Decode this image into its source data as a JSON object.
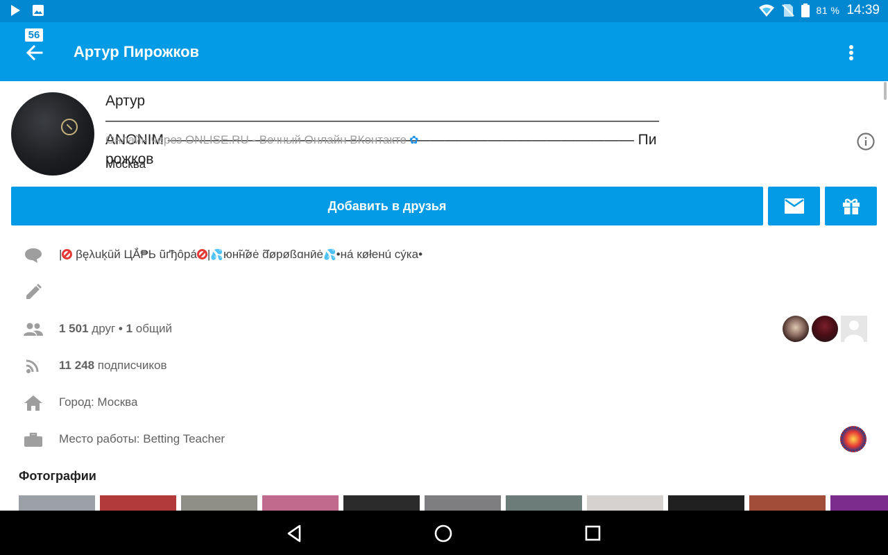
{
  "status_bar": {
    "battery_text": "81 %",
    "time": "14:39",
    "icons": [
      "play-icon",
      "image-icon",
      "wifi-icon",
      "no-sim-icon",
      "battery-icon"
    ]
  },
  "app_bar": {
    "badge": "56",
    "title": "Артур Пирожков"
  },
  "profile": {
    "name": "Артур ——————————————————————————————————————ANONIM ———————————————————————————————— Пирожков",
    "status": "Онлайн через ONLISE.RU - Вечный Онлайн ВКонтакте",
    "city": "Москва"
  },
  "actions": {
    "add_friend": "Добавить в друзья"
  },
  "rows": {
    "quote": {
      "part1": "|",
      "part2": "βęλuķūй ЦẮ₱Ь ũґђôрá",
      "part3": "|",
      "part4": "юн̃н̃øė ɗ̃øрøßɑнӣė",
      "part5": "•нá кøłенú сýка•"
    },
    "friends": {
      "count": "1 501",
      "friends_word": "друг",
      "sep": "•",
      "mutual_count": "1",
      "mutual_word": "общий"
    },
    "followers": {
      "count": "11 248",
      "word": "подписчиков"
    },
    "city": "Город: Москва",
    "work": "Место работы: Betting Teacher"
  },
  "photos": {
    "title": "Фотографии",
    "thumb_colors": [
      "#9aa0a6",
      "#b23a3a",
      "#8e8e86",
      "#c06a8e",
      "#2b2b2b",
      "#7e7e80",
      "#6c7c78",
      "#d6d2cf",
      "#202020",
      "#a24c3a",
      "#7c2c8c",
      "#111111"
    ]
  },
  "colors": {
    "status_bar": "#0288d1",
    "app_bar": "#039be5",
    "accent": "#039be5"
  }
}
